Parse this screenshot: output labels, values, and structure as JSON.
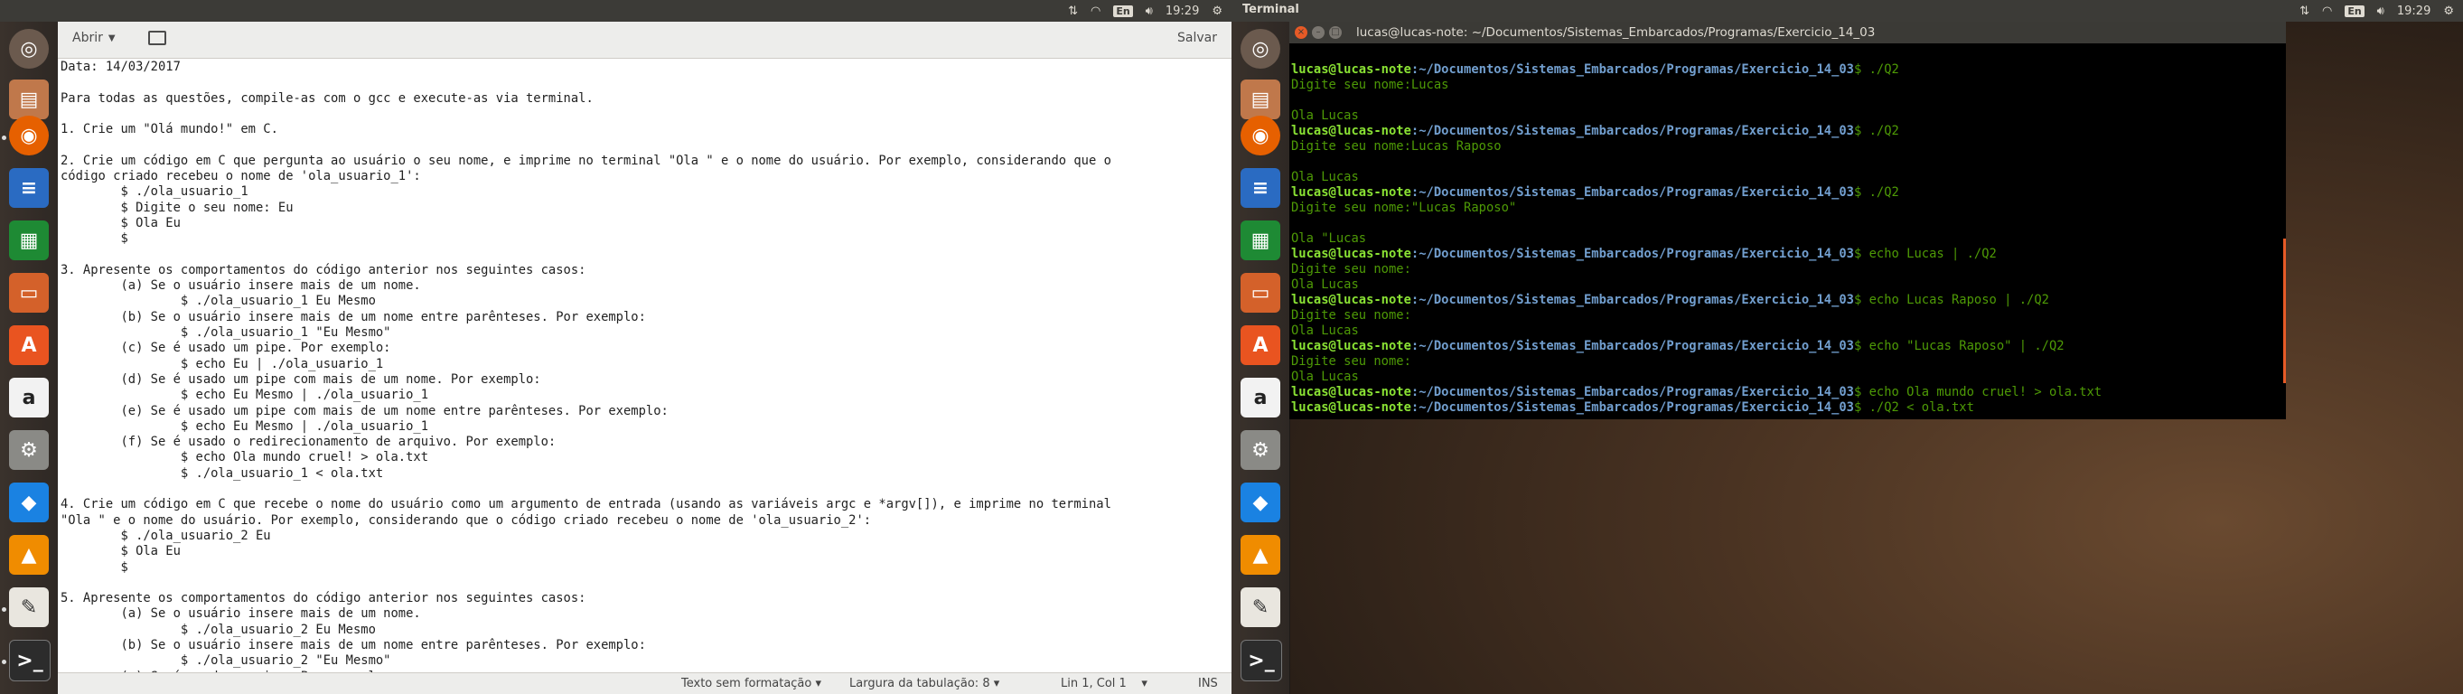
{
  "left_screen": {
    "topbar": {
      "keyboard_layout": "En",
      "time": "19:29",
      "icons": [
        "network-updown-icon",
        "wifi-icon",
        "keyboard-icon",
        "volume-icon",
        "clock",
        "gear-icon"
      ]
    },
    "launcher": [
      "ubuntu-dash-icon",
      "files-icon",
      "firefox-icon",
      "libreoffice-writer-icon",
      "libreoffice-calc-icon",
      "libreoffice-impress-icon",
      "software-center-icon",
      "amazon-icon",
      "system-settings-icon",
      "dropbox-icon",
      "vlc-icon",
      "text-editor-icon",
      "terminal-icon"
    ],
    "gedit": {
      "open_label": "Abrir",
      "save_label": "Salvar",
      "lines": [
        "Data: 14/03/2017",
        "",
        "Para todas as questões, compile-as com o gcc e execute-as via terminal.",
        "",
        "1. Crie um \"Olá mundo!\" em C.",
        "",
        "2. Crie um código em C que pergunta ao usuário o seu nome, e imprime no terminal \"Ola \" e o nome do usuário. Por exemplo, considerando que o",
        "código criado recebeu o nome de 'ola_usuario_1':",
        "        $ ./ola_usuario_1",
        "        $ Digite o seu nome: Eu",
        "        $ Ola Eu",
        "        $",
        "",
        "3. Apresente os comportamentos do código anterior nos seguintes casos:",
        "        (a) Se o usuário insere mais de um nome.",
        "                $ ./ola_usuario_1 Eu Mesmo",
        "        (b) Se o usuário insere mais de um nome entre parênteses. Por exemplo:",
        "                $ ./ola_usuario_1 \"Eu Mesmo\"",
        "        (c) Se é usado um pipe. Por exemplo:",
        "                $ echo Eu | ./ola_usuario_1",
        "        (d) Se é usado um pipe com mais de um nome. Por exemplo:",
        "                $ echo Eu Mesmo | ./ola_usuario_1",
        "        (e) Se é usado um pipe com mais de um nome entre parênteses. Por exemplo:",
        "                $ echo Eu Mesmo | ./ola_usuario_1",
        "        (f) Se é usado o redirecionamento de arquivo. Por exemplo:",
        "                $ echo Ola mundo cruel! > ola.txt",
        "                $ ./ola_usuario_1 < ola.txt",
        "",
        "4. Crie um código em C que recebe o nome do usuário como um argumento de entrada (usando as variáveis argc e *argv[]), e imprime no terminal",
        "\"Ola \" e o nome do usuário. Por exemplo, considerando que o código criado recebeu o nome de 'ola_usuario_2':",
        "        $ ./ola_usuario_2 Eu",
        "        $ Ola Eu",
        "        $",
        "",
        "5. Apresente os comportamentos do código anterior nos seguintes casos:",
        "        (a) Se o usuário insere mais de um nome.",
        "                $ ./ola_usuario_2 Eu Mesmo",
        "        (b) Se o usuário insere mais de um nome entre parênteses. Por exemplo:",
        "                $ ./ola_usuario_2 \"Eu Mesmo\"",
        "        (c) Se é usado um pipe. Por exemplo:"
      ],
      "status": {
        "format": "Texto sem formatação",
        "tab_width": "Largura da tabulação: 8",
        "position": "Lin 1, Col 1",
        "mode": "INS"
      }
    }
  },
  "right_screen": {
    "topbar": {
      "app_title": "Terminal",
      "keyboard_layout": "En",
      "time": "19:29"
    },
    "terminal": {
      "title": "lucas@lucas-note: ~/Documentos/Sistemas_Embarcados/Programas/Exercicio_14_03",
      "prompt_user": "lucas@lucas-note",
      "prompt_path": ":~/Documentos/Sistemas_Embarcados/Programas/Exercicio_14_03",
      "lines": [
        {
          "kind": "blank"
        },
        {
          "kind": "prompt",
          "cmd": "$ ./Q2"
        },
        {
          "kind": "out",
          "text": "Digite seu nome:Lucas"
        },
        {
          "kind": "blank"
        },
        {
          "kind": "out",
          "text": "Ola Lucas"
        },
        {
          "kind": "prompt",
          "cmd": "$ ./Q2"
        },
        {
          "kind": "out",
          "text": "Digite seu nome:Lucas Raposo"
        },
        {
          "kind": "blank"
        },
        {
          "kind": "out",
          "text": "Ola Lucas"
        },
        {
          "kind": "prompt",
          "cmd": "$ ./Q2"
        },
        {
          "kind": "out",
          "text": "Digite seu nome:\"Lucas Raposo\""
        },
        {
          "kind": "blank"
        },
        {
          "kind": "out",
          "text": "Ola \"Lucas"
        },
        {
          "kind": "prompt",
          "cmd": "$ echo Lucas | ./Q2"
        },
        {
          "kind": "out",
          "text": "Digite seu nome:"
        },
        {
          "kind": "out",
          "text": "Ola Lucas"
        },
        {
          "kind": "prompt",
          "cmd": "$ echo Lucas Raposo | ./Q2"
        },
        {
          "kind": "out",
          "text": "Digite seu nome:"
        },
        {
          "kind": "out",
          "text": "Ola Lucas"
        },
        {
          "kind": "prompt",
          "cmd": "$ echo \"Lucas Raposo\" | ./Q2"
        },
        {
          "kind": "out",
          "text": "Digite seu nome:"
        },
        {
          "kind": "out",
          "text": "Ola Lucas"
        },
        {
          "kind": "prompt",
          "cmd": "$ echo Ola mundo cruel! > ola.txt"
        },
        {
          "kind": "prompt",
          "cmd": "$ ./Q2 < ola.txt"
        }
      ]
    }
  },
  "colors": {
    "prompt_user": "#8ae234",
    "prompt_path": "#729fcf",
    "output_text": "#4e9a06",
    "topbar": "#3c3b37",
    "close_button": "#e65a26"
  }
}
